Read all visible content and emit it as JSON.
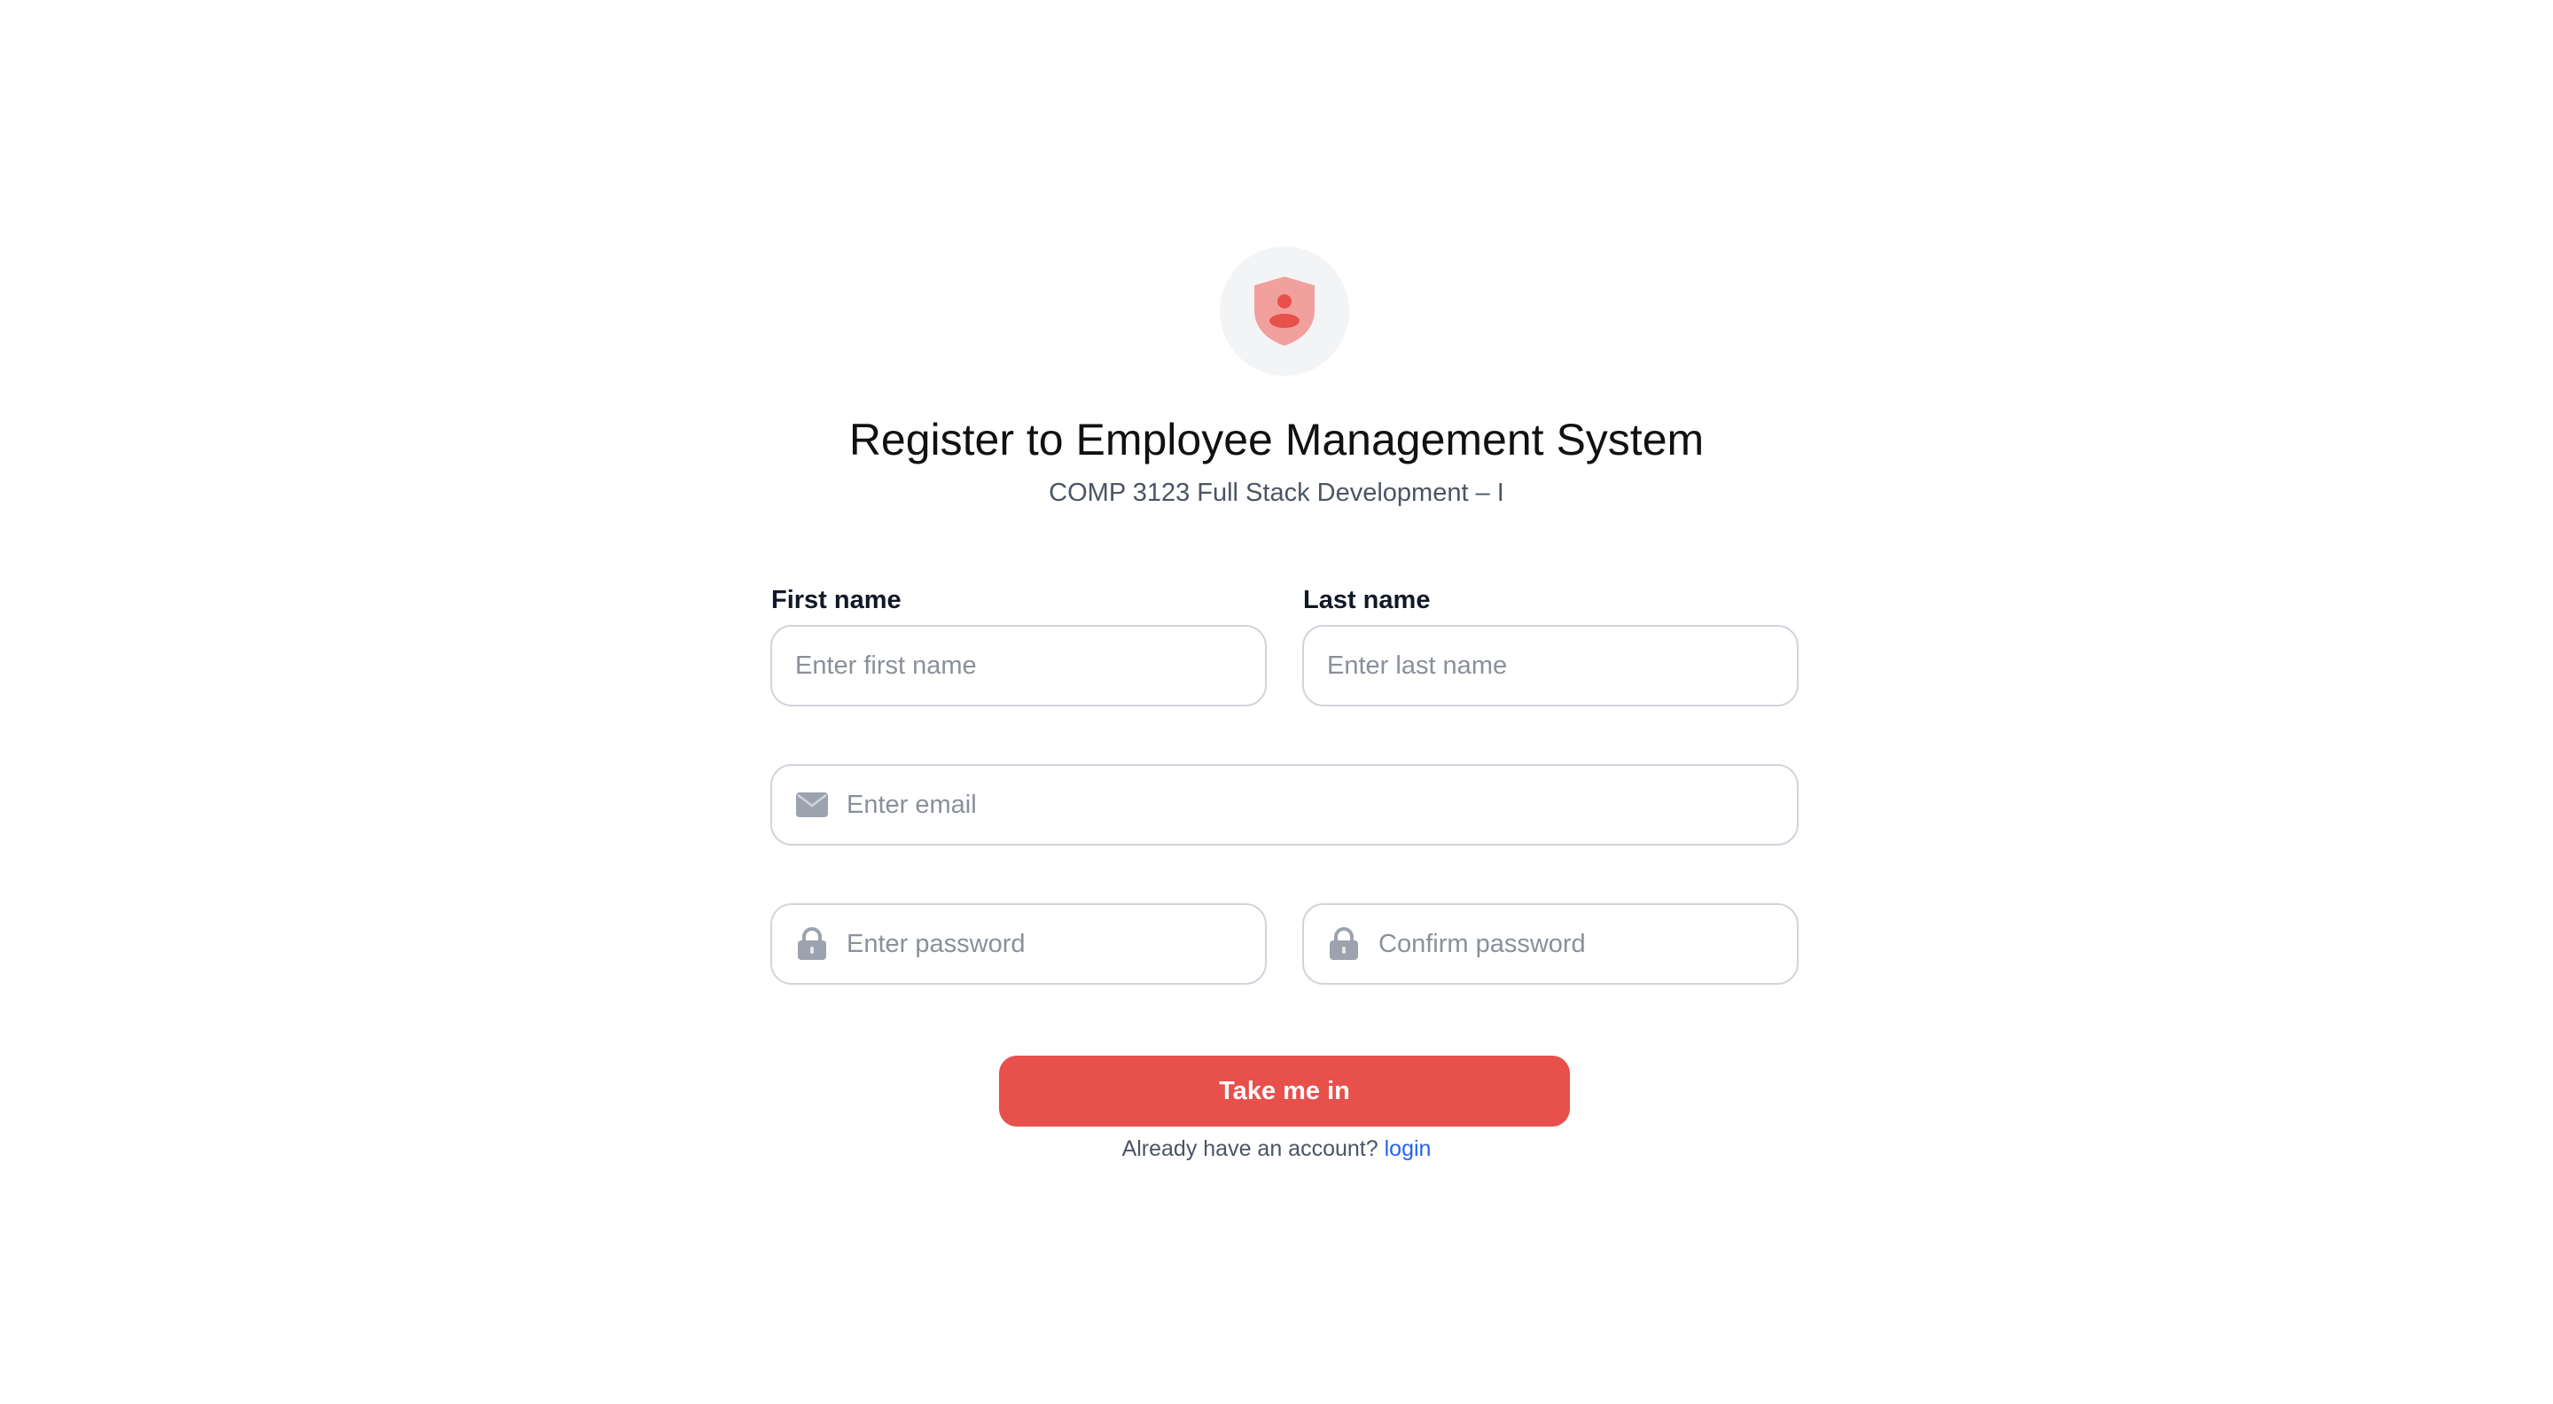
{
  "header": {
    "logo_icon": "shield-user-icon",
    "title": "Register to Employee Management System",
    "subtitle": "COMP 3123 Full Stack Development – I"
  },
  "form": {
    "first_name_label": "First name",
    "first_name_placeholder": "Enter first name",
    "last_name_label": "Last name",
    "last_name_placeholder": "Enter last name",
    "email_icon": "envelope-icon",
    "email_placeholder": "Enter email",
    "password_icon": "lock-icon",
    "password_placeholder": "Enter password",
    "confirm_password_icon": "lock-icon",
    "confirm_password_placeholder": "Confirm password",
    "submit_label": "Take me in"
  },
  "footer": {
    "prompt": "Already have an account?",
    "login_link": "login"
  },
  "colors": {
    "accent": "#e8504b",
    "link": "#2563eb",
    "input_border": "#d1d5db",
    "logo_bg": "#f3f4f6"
  }
}
